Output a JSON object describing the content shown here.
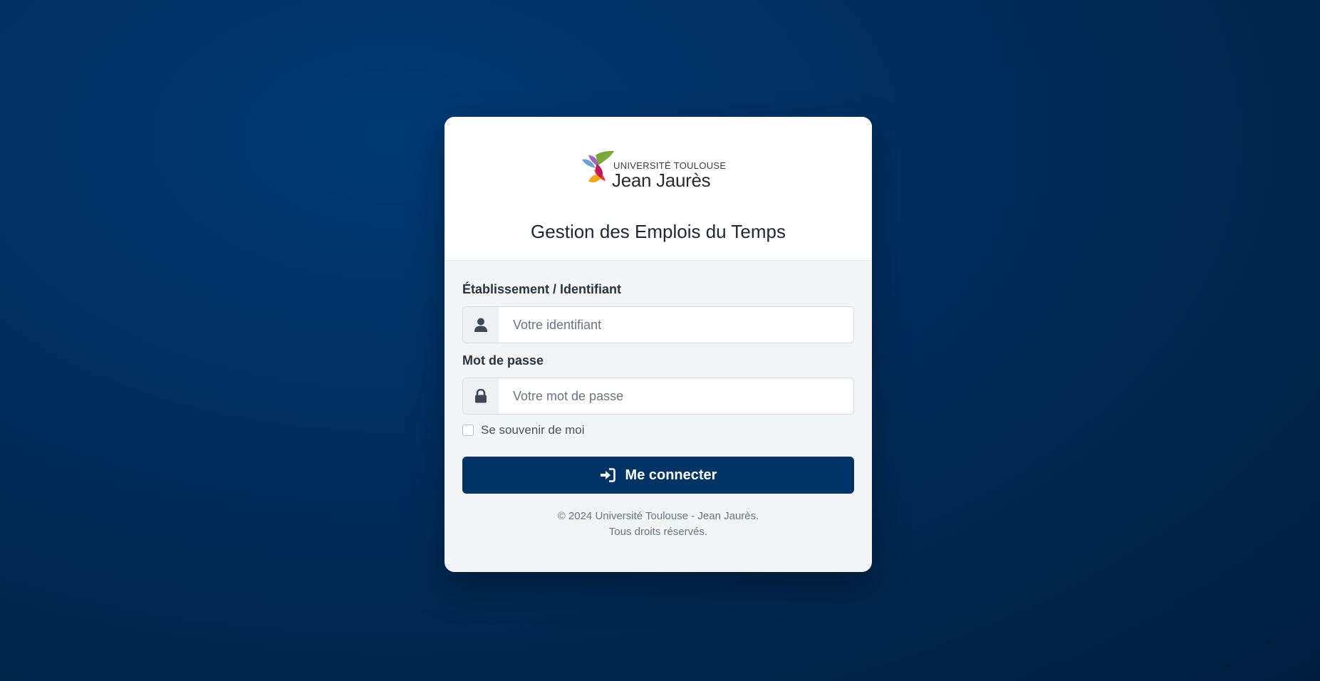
{
  "logo": {
    "line1": "UNIVERSITÉ TOULOUSE",
    "line2": "Jean Jaurès"
  },
  "header": {
    "title": "Gestion des Emplois du Temps"
  },
  "form": {
    "identifier": {
      "label": "Établissement / Identifiant",
      "placeholder": "Votre identifiant",
      "value": "",
      "icon": "user-icon"
    },
    "password": {
      "label": "Mot de passe",
      "placeholder": "Votre mot de passe",
      "value": "",
      "icon": "lock-icon"
    },
    "remember": {
      "label": "Se souvenir de moi",
      "checked": false
    },
    "submit": {
      "label": "Me connecter",
      "icon": "sign-in-icon"
    }
  },
  "footer": {
    "line1": "© 2024 Université Toulouse - Jean Jaurès.",
    "line2": "Tous droits réservés."
  },
  "colors": {
    "primary": "#003366",
    "background": "#002d5c",
    "card": "#f2f4f6"
  }
}
